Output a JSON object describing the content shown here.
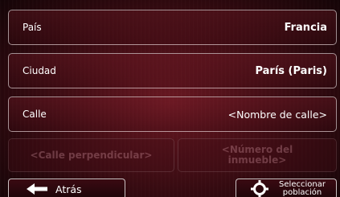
{
  "fields": {
    "country": {
      "label": "País",
      "value": "Francia"
    },
    "city": {
      "label": "Ciudad",
      "value": "París (Paris)"
    },
    "street": {
      "label": "Calle",
      "value": "<Nombre de calle>"
    }
  },
  "secondary_buttons": {
    "cross_street": "<Calle perpendicular>",
    "house_number_line1": "<Número del",
    "house_number_line2": "inmueble>"
  },
  "bottom_bar": {
    "back_label": "Atrás",
    "select_town_line1": "Seleccionar",
    "select_town_line2": "población"
  },
  "icons": {
    "back": "arrow-left-icon",
    "select_town": "crosshair-icon"
  },
  "colors": {
    "background": "#4a0f17",
    "text": "#ffffff",
    "disabled_text": "#a05a66"
  }
}
